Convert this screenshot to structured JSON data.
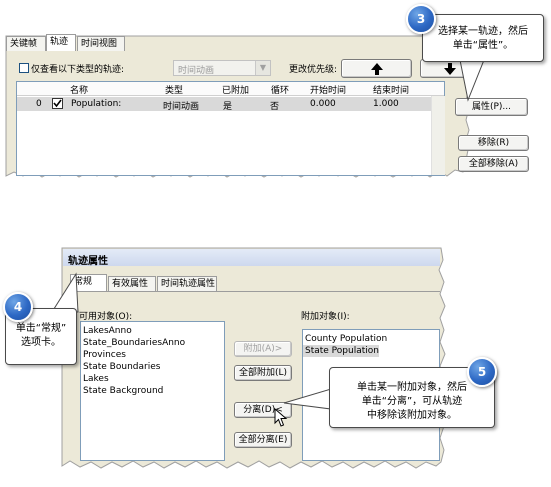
{
  "top_panel": {
    "tabs": [
      "关键帧",
      "轨迹",
      "时间视图"
    ],
    "filter_checkbox_label": "仅查看以下类型的轨迹:",
    "filter_type_value": "时间动画",
    "priority_label": "更改优先级:",
    "columns": [
      "名称",
      "类型",
      "已附加",
      "循环",
      "开始时间",
      "结束时间"
    ],
    "rows": [
      {
        "index": "0",
        "checked": true,
        "name": "Population:",
        "type": "时间动画",
        "attached": "是",
        "loop": "否",
        "start": "0.000",
        "end": "1.000"
      }
    ],
    "properties_button": "属性(P)...",
    "remove_button": "移除(R)",
    "remove_all_button": "全部移除(A)"
  },
  "bottom_panel": {
    "title": "轨迹属性",
    "tabs": [
      "常规",
      "有效属性",
      "时间轨迹属性"
    ],
    "available_label": "可用对象(O):",
    "available_items": [
      "LakesAnno",
      "State_BoundariesAnno",
      "Provinces",
      "State Boundaries",
      "Lakes",
      "State Background"
    ],
    "attach_button": "附加(A)>",
    "attach_all_button": "全部附加(L)",
    "detach_button": "分离(D)<",
    "detach_all_button": "全部分离(E)",
    "attached_label": "附加对象(I):",
    "attached_items": [
      "County Population",
      "State Population"
    ]
  },
  "callouts": {
    "c3": {
      "number": "3",
      "line1": "选择某一轨迹，然后",
      "line2": "单击“属性”。"
    },
    "c4": {
      "number": "4",
      "line1": "单击“常规”",
      "line2": "选项卡。"
    },
    "c5": {
      "number": "5",
      "line1": "单击某一附加对象，然后",
      "line2": "单击“分离”，可从轨迹",
      "line3": "中移除该附加对象。"
    }
  },
  "colors": {
    "badge": "#2d68c4",
    "panel": "#ece9d8",
    "selection": "#d9d9d9",
    "title_bar": "#d6dff0"
  }
}
